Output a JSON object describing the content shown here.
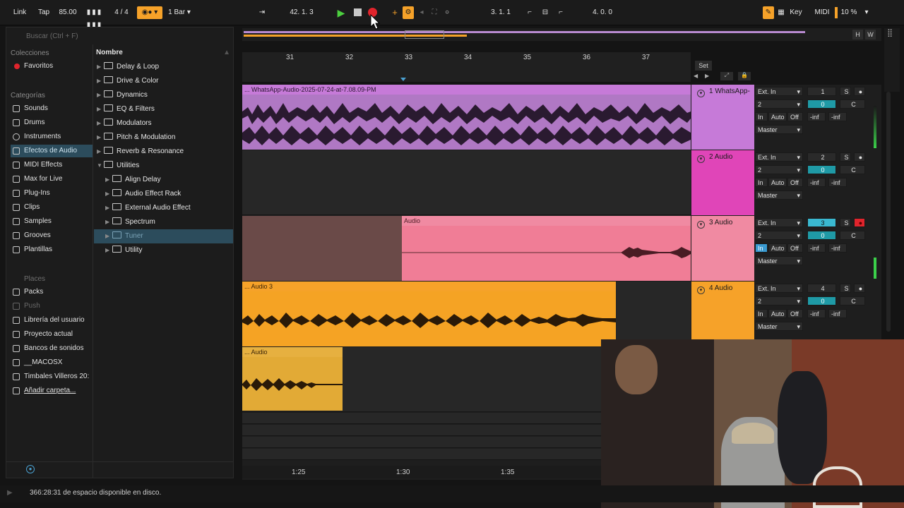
{
  "topbar": {
    "link": "Link",
    "tap": "Tap",
    "tempo": "85.00",
    "meter": "4 / 4",
    "quantize": "1 Bar",
    "position": "42.  1.  3",
    "loop_start": "3.  1.  1",
    "loop_length": "4.  0.  0",
    "key": "Key",
    "midi": "MIDI",
    "cpu": "10 %"
  },
  "browser": {
    "search_placeholder": "Buscar (Ctrl + F)",
    "collections_label": "Colecciones",
    "favorites": "Favoritos",
    "categories_label": "Categorías",
    "categories": [
      "Sounds",
      "Drums",
      "Instruments",
      "Efectos de Audio",
      "MIDI Effects",
      "Max for Live",
      "Plug-Ins",
      "Clips",
      "Samples",
      "Grooves",
      "Plantillas"
    ],
    "places_label": "Places",
    "places": [
      "Packs",
      "Push",
      "Librería del usuario",
      "Proyecto actual",
      "Bancos de sonidos",
      "__MACOSX",
      "Timbales Villeros 20:",
      "Añadir carpeta..."
    ],
    "column_header": "Nombre",
    "tree": [
      "Delay & Loop",
      "Drive & Color",
      "Dynamics",
      "EQ & Filters",
      "Modulators",
      "Pitch & Modulation",
      "Reverb & Resonance",
      "Utilities",
      "Align Delay",
      "Audio Effect Rack",
      "External Audio Effect",
      "Spectrum",
      "Tuner",
      "Utility"
    ]
  },
  "ruler": {
    "bars": [
      "31",
      "32",
      "33",
      "34",
      "35",
      "36",
      "37"
    ],
    "set_label": "Set",
    "time": [
      "1:25",
      "1:30",
      "1:35"
    ]
  },
  "tracks": [
    {
      "name": "1 WhatsApp-",
      "clip": "... WhatsApp-Audio-2025-07-24-at-7.08.09-PM",
      "color": "#c67ad8",
      "input": "Ext. In",
      "channel": "2",
      "num": "1",
      "vol": "0",
      "pan": "C",
      "monitor": "Auto",
      "off": "Off",
      "out": "Master",
      "peak_l": "-inf",
      "peak_r": "-inf"
    },
    {
      "name": "2 Audio",
      "clip": "",
      "color": "#e045b8",
      "input": "Ext. In",
      "channel": "2",
      "num": "2",
      "vol": "0",
      "pan": "C",
      "monitor": "Auto",
      "off": "Off",
      "out": "Master",
      "peak_l": "-inf",
      "peak_r": "-inf"
    },
    {
      "name": "3 Audio",
      "clip": "Audio",
      "color": "#f08aa2",
      "input": "Ext. In",
      "channel": "2",
      "num": "3",
      "vol": "0",
      "pan": "C",
      "monitor": "Auto",
      "off": "Off",
      "out": "Master",
      "peak_l": "-inf",
      "peak_r": "-inf"
    },
    {
      "name": "4 Audio",
      "clip": "... Audio 3",
      "color": "#f6a229",
      "input": "Ext. In",
      "channel": "2",
      "num": "4",
      "vol": "0",
      "pan": "C",
      "monitor": "Auto",
      "off": "Off",
      "out": "Master",
      "peak_l": "-inf",
      "peak_r": "-inf"
    }
  ],
  "extra_clip": "... Audio",
  "io_labels": {
    "in": "In",
    "solo": "S"
  },
  "status": "366:28:31 de espacio disponible en disco.",
  "overview_buttons": {
    "h": "H",
    "w": "W"
  },
  "colors": {
    "accent": "#f6a229",
    "play": "#4ccf3f",
    "record": "#e0242c",
    "selection": "#2c4c5c"
  }
}
